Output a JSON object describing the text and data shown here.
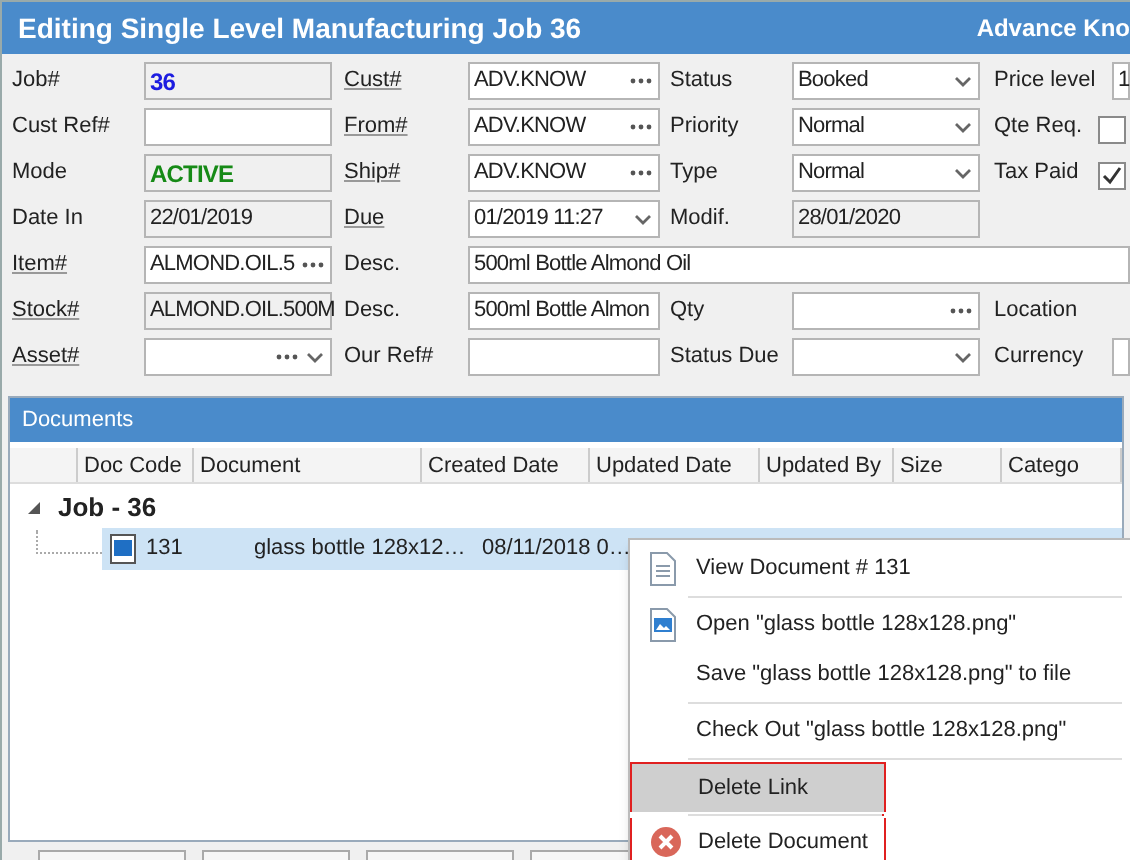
{
  "window": {
    "title": "Editing Single Level Manufacturing Job 36",
    "brand": "Advance Kno"
  },
  "form_rows": [
    [
      {
        "label": "Job#",
        "link": false,
        "field": {
          "kind": "text",
          "value": "36",
          "readonly": true,
          "color": "#1c1ce0"
        }
      },
      {
        "label": "Cust#",
        "link": true,
        "field": {
          "kind": "lookup",
          "value": "ADV.KNOW",
          "readonly": false
        }
      },
      {
        "label": "Status",
        "link": false,
        "field": {
          "kind": "dropdown",
          "value": "Booked",
          "readonly": false
        }
      },
      {
        "label": "Price level",
        "link": false,
        "field": {
          "kind": "text",
          "value": "1",
          "readonly": false
        }
      }
    ],
    [
      {
        "label": "Cust Ref#",
        "link": false,
        "field": {
          "kind": "text",
          "readonly": false
        }
      },
      {
        "label": "From#",
        "link": true,
        "field": {
          "kind": "lookup",
          "value": "ADV.KNOW",
          "readonly": false
        }
      },
      {
        "label": "Priority",
        "link": false,
        "field": {
          "kind": "dropdown",
          "value": "Normal",
          "readonly": false
        }
      },
      {
        "label": "Qte Req.",
        "link": false,
        "field": {
          "kind": "checkbox",
          "checked": false
        }
      }
    ],
    [
      {
        "label": "Mode",
        "link": false,
        "field": {
          "kind": "text",
          "value": "ACTIVE",
          "readonly": true,
          "color": "#168a16"
        }
      },
      {
        "label": "Ship#",
        "link": true,
        "field": {
          "kind": "lookup",
          "value": "ADV.KNOW",
          "readonly": false
        }
      },
      {
        "label": "Type",
        "link": false,
        "field": {
          "kind": "dropdown",
          "value": "Normal",
          "readonly": false
        }
      },
      {
        "label": "Tax Paid",
        "link": false,
        "field": {
          "kind": "checkbox",
          "checked": true
        }
      }
    ],
    [
      {
        "label": "Date In",
        "link": false,
        "field": {
          "kind": "text",
          "value": "22/01/2019",
          "readonly": true
        }
      },
      {
        "label": "Due",
        "link": true,
        "field": {
          "kind": "dropdown",
          "value": "01/2019 11:27",
          "readonly": false
        }
      },
      {
        "label": "Modif.",
        "link": false,
        "field": {
          "kind": "text",
          "value": "28/01/2020",
          "readonly": true
        }
      }
    ],
    [
      {
        "label": "Item#",
        "link": true,
        "field": {
          "kind": "lookup",
          "value": "ALMOND.OIL.5",
          "readonly": false
        }
      },
      {
        "label": "Desc.",
        "link": false,
        "field": {
          "kind": "wide",
          "value": "500ml Bottle Almond Oil",
          "readonly": false
        }
      }
    ],
    [
      {
        "label": "Stock#",
        "link": true,
        "field": {
          "kind": "text",
          "value": "ALMOND.OIL.500M",
          "readonly": true
        }
      },
      {
        "label": "Desc.",
        "link": false,
        "field": {
          "kind": "text",
          "value": "500ml Bottle Almon",
          "readonly": false
        }
      },
      {
        "label": "Qty",
        "link": false,
        "field": {
          "kind": "lookup",
          "readonly": false
        }
      },
      {
        "label": "Location",
        "link": false
      }
    ],
    [
      {
        "label": "Asset#",
        "link": true,
        "field": {
          "kind": "lookupdropdown",
          "readonly": false
        }
      },
      {
        "label": "Our Ref#",
        "link": false,
        "field": {
          "kind": "text",
          "readonly": false
        }
      },
      {
        "label": "Status Due",
        "link": false,
        "field": {
          "kind": "dropdown",
          "readonly": false
        }
      },
      {
        "label": "Currency",
        "link": false,
        "field": {
          "kind": "text",
          "readonly": false
        }
      }
    ]
  ],
  "documents": {
    "title": "Documents",
    "columns": [
      "Doc Code",
      "Document",
      "Created Date",
      "Updated Date",
      "Updated By",
      "Size",
      "Catego"
    ],
    "group": {
      "label": "Job - 36",
      "expanded": true
    },
    "rows": [
      {
        "cells": [
          "131",
          "glass bottle 128x12…",
          "08/11/2018 0…"
        ],
        "selected": true
      }
    ]
  },
  "context_menu": [
    {
      "label": "View Document # 131",
      "kind": "document",
      "selected": false,
      "separator_after": true,
      "outlined": false
    },
    {
      "label": "Open \"glass bottle 128x128.png\"",
      "kind": "image",
      "selected": false,
      "separator_after": false,
      "outlined": false
    },
    {
      "label": "Save \"glass bottle 128x128.png\" to file",
      "kind": "plain",
      "selected": false,
      "separator_after": true,
      "outlined": false
    },
    {
      "label": "Check Out \"glass bottle 128x128.png\"",
      "kind": "plain",
      "selected": false,
      "separator_after": true,
      "outlined": false
    },
    {
      "label": "Delete Link",
      "kind": "plain",
      "selected": true,
      "separator_after": true,
      "outlined": true
    },
    {
      "label": "Delete Document",
      "kind": "delete",
      "selected": false,
      "separator_after": false,
      "outlined": true
    }
  ]
}
